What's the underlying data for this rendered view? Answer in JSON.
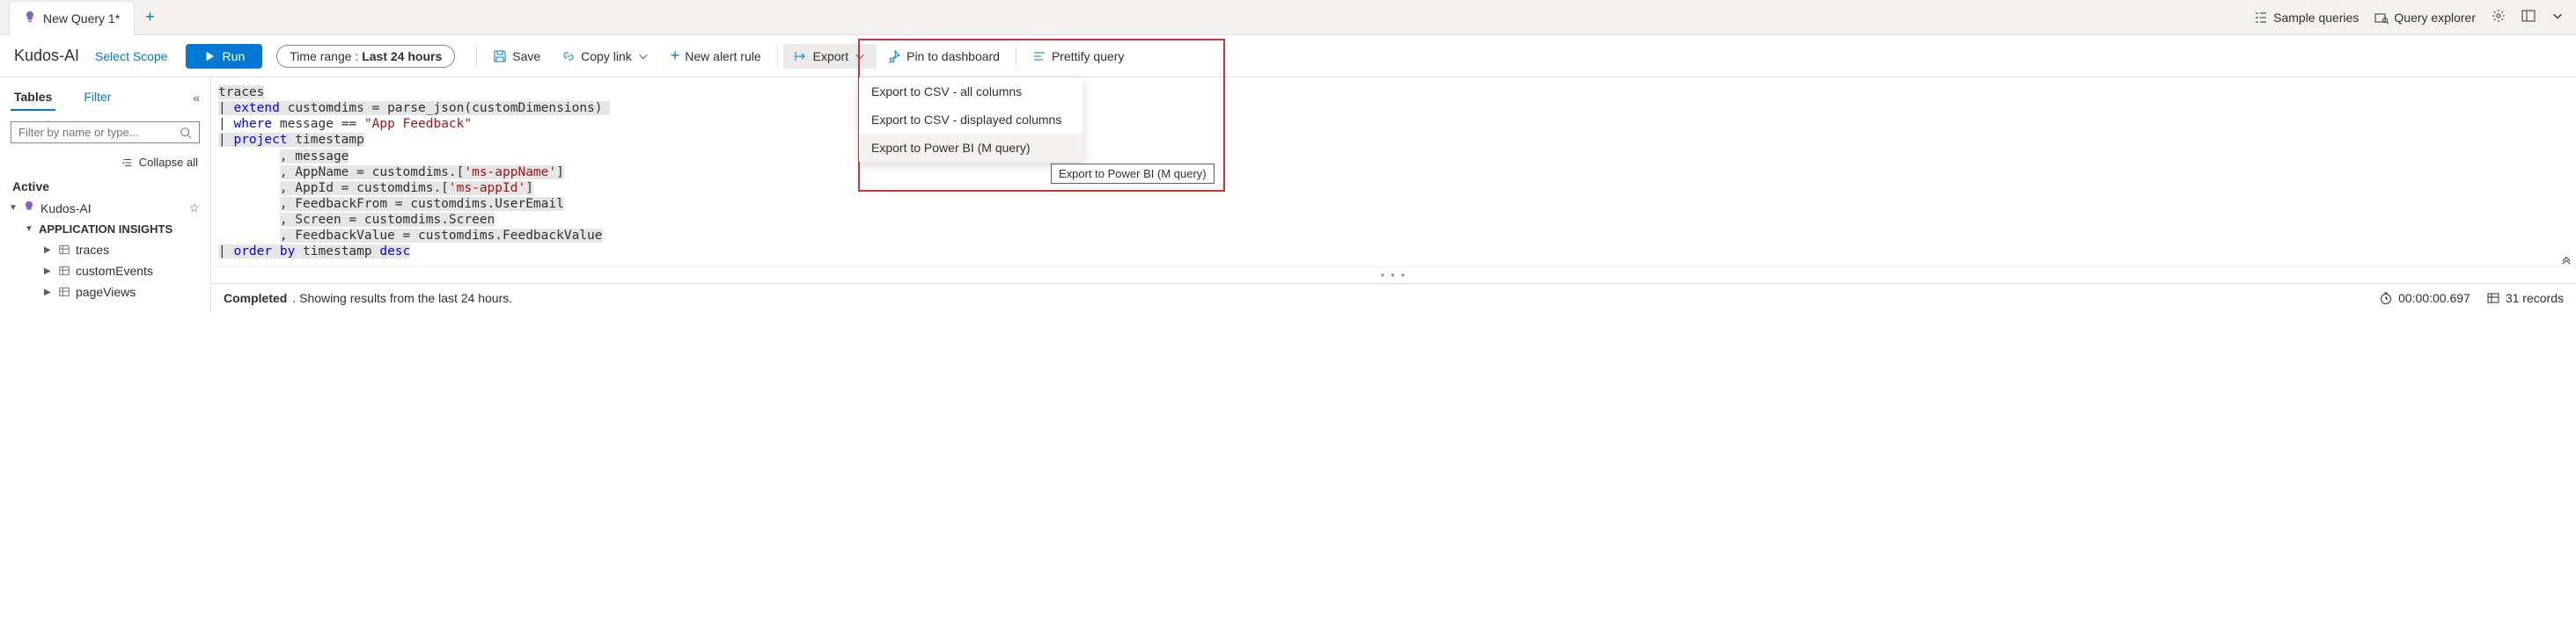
{
  "tabs": {
    "active": "New Query 1*"
  },
  "top_actions": {
    "sample": "Sample queries",
    "explorer": "Query explorer"
  },
  "toolbar": {
    "scope_name": "Kudos-AI",
    "select_scope": "Select Scope",
    "run": "Run",
    "time_range_label": "Time range : ",
    "time_range_value": "Last 24 hours",
    "save": "Save",
    "copy_link": "Copy link",
    "new_alert": "New alert rule",
    "export": "Export",
    "pin": "Pin to dashboard",
    "prettify": "Prettify query"
  },
  "sidebar": {
    "tab_tables": "Tables",
    "tab_filter": "Filter",
    "filter_placeholder": "Filter by name or type...",
    "collapse_all": "Collapse all",
    "active_label": "Active",
    "root": "Kudos-AI",
    "group": "APPLICATION INSIGHTS",
    "items": [
      "traces",
      "customEvents",
      "pageViews"
    ]
  },
  "code_lines": [
    {
      "t": "traces",
      "cls": "hl-bg"
    },
    {
      "pipe": true,
      "raw": " <span class='kw-blue'>extend</span> customdims = parse_json(customDimensions) ",
      "cls": "hl-bg"
    },
    {
      "pipe": true,
      "raw": " <span class='kw-blue'>where</span> message == <span class='lit-red'>\"App Feedback\"</span>",
      "cls": ""
    },
    {
      "pipe": true,
      "raw": " <span class='kw-blue'>project</span> timestamp",
      "cls": "hl-bg"
    },
    {
      "indent": true,
      "raw": ", message",
      "cls": "hl-bg"
    },
    {
      "indent": true,
      "raw": ", AppName = customdims.[<span class='lit-darkred'>'ms-appName'</span>]",
      "cls": "hl-bg"
    },
    {
      "indent": true,
      "raw": ", AppId = customdims.[<span class='lit-darkred'>'ms-appId'</span>]",
      "cls": "hl-bg"
    },
    {
      "indent": true,
      "raw": ", FeedbackFrom = customdims.UserEmail",
      "cls": "hl-bg"
    },
    {
      "indent": true,
      "raw": ", Screen = customdims.Screen",
      "cls": "hl-bg"
    },
    {
      "indent": true,
      "raw": ", FeedbackValue = customdims.FeedbackValue",
      "cls": "hl-bg"
    },
    {
      "pipe": true,
      "raw": " <span class='kw-blue'>order by</span> timestamp <span class='kw-blue'>desc</span>",
      "cls": "hl-bg"
    }
  ],
  "export_menu": {
    "items": [
      "Export to CSV - all columns",
      "Export to CSV - displayed columns",
      "Export to Power BI (M query)"
    ],
    "hover_idx": 2,
    "tooltip": "Export to Power BI (M query)"
  },
  "status": {
    "completed": "Completed",
    "detail": ". Showing results from the last 24 hours.",
    "time": "00:00:00.697",
    "records": "31 records"
  }
}
